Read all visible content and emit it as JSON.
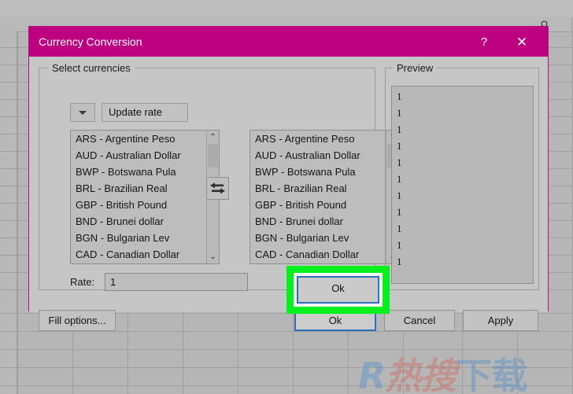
{
  "spreadsheet": {
    "column_headers": [
      "O"
    ],
    "watermark": {
      "letter": "R",
      "red_text": "热搜",
      "blue_text": "下载"
    }
  },
  "dialog": {
    "title": "Currency Conversion",
    "help_icon": "?",
    "close_icon": "✕",
    "accent_color": "#bd007f",
    "select_group": {
      "label": "Select currencies",
      "dropdown_icon": "chevron-down-icon",
      "update_rate_label": "Update rate",
      "swap_icon": "swap-arrows-icon",
      "left_list": [
        "ARS - Argentine Peso",
        "AUD - Australian Dollar",
        "BWP - Botswana Pula",
        "BRL - Brazilian Real",
        "GBP - British Pound",
        "BND - Brunei dollar",
        "BGN - Bulgarian Lev",
        "CAD - Canadian Dollar"
      ],
      "right_list": [
        "ARS - Argentine Peso",
        "AUD - Australian Dollar",
        "BWP - Botswana Pula",
        "BRL - Brazilian Real",
        "GBP - British Pound",
        "BND - Brunei dollar",
        "BGN - Bulgarian Lev",
        "CAD - Canadian Dollar"
      ],
      "scroll_up_icon": "⌃",
      "scroll_down_icon": "⌄"
    },
    "rate": {
      "label": "Rate:",
      "value": "1"
    },
    "preview": {
      "label": "Preview",
      "rows": [
        "1",
        "1",
        "1",
        "1",
        "1",
        "1",
        "1",
        "1",
        "1",
        "1",
        "1"
      ]
    },
    "buttons": {
      "fill_options": "Fill options...",
      "ok": "Ok",
      "cancel": "Cancel",
      "apply": "Apply"
    },
    "highlight": {
      "color": "#00f11d",
      "target": "ok-button"
    }
  }
}
